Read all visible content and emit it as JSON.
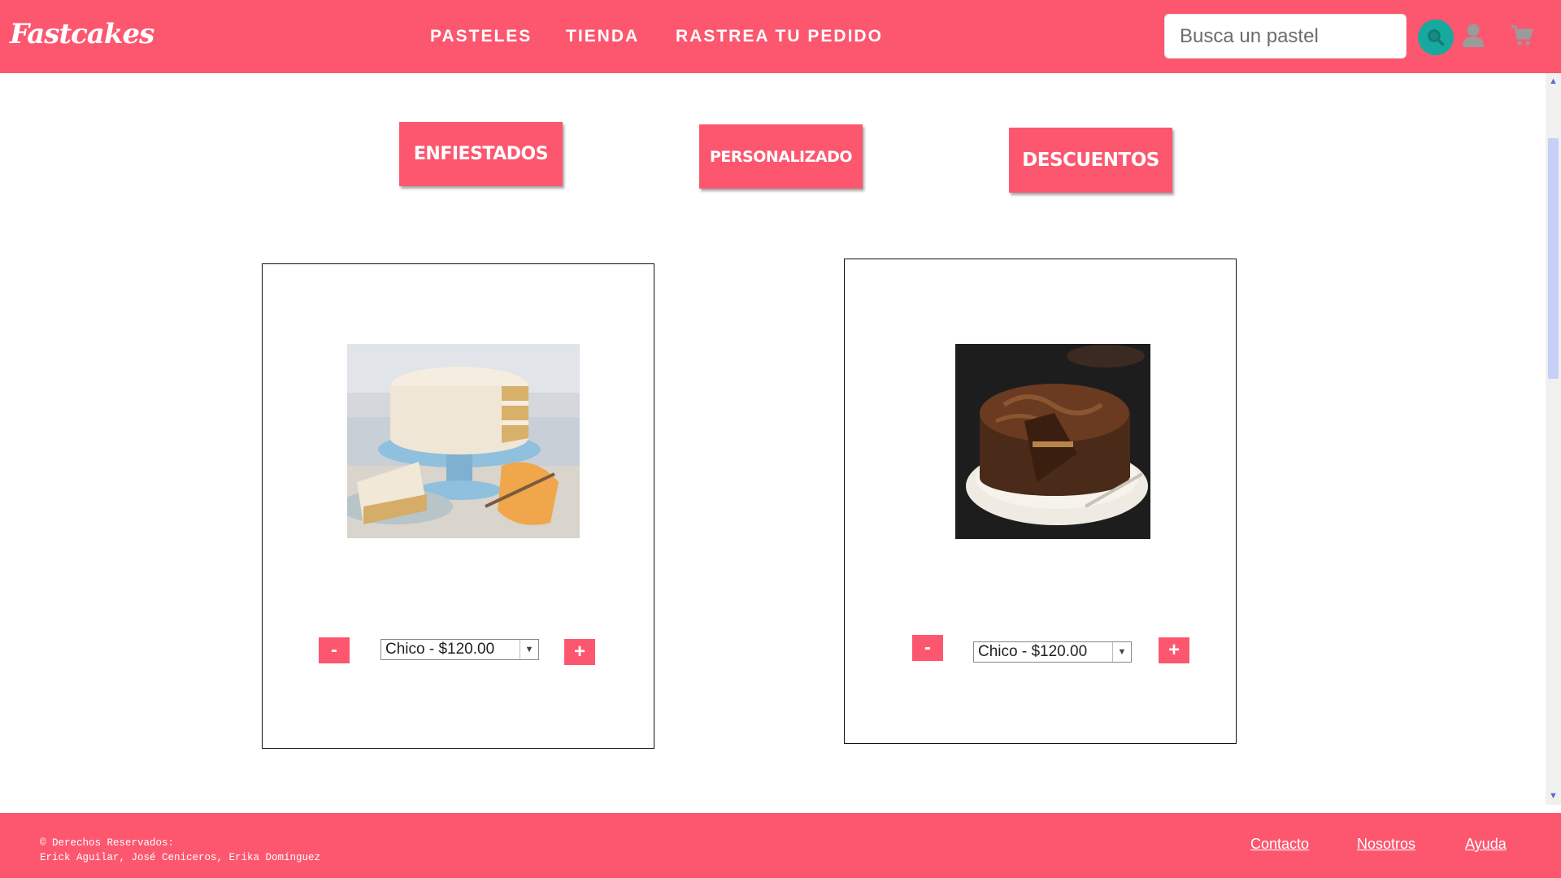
{
  "header": {
    "logo": "Fastcakes",
    "nav": [
      "PASTELES",
      "TIENDA",
      "RASTREA TU PEDIDO"
    ],
    "search_placeholder": "Busca un pastel",
    "icons": [
      "search-icon",
      "user-icon",
      "cart-icon"
    ]
  },
  "categories": [
    "ENFIESTADOS",
    "PERSONALIZADO",
    "DESCUENTOS"
  ],
  "products": [
    {
      "image": "vanilla-layer-cake",
      "size_option": "Chico - $120.00",
      "minus": "-",
      "plus": "+"
    },
    {
      "image": "chocolate-cake",
      "size_option": "Chico - $120.00",
      "minus": "-",
      "plus": "+"
    }
  ],
  "footer": {
    "copyright_line1": "© Derechos Reservados:",
    "copyright_line2": "Erick Aguilar, José Ceniceros, Erika Domínguez",
    "links": [
      "Contacto",
      "Nosotros",
      "Ayuda"
    ]
  },
  "colors": {
    "brand": "#fc576f",
    "search_button": "#17a8a0"
  }
}
